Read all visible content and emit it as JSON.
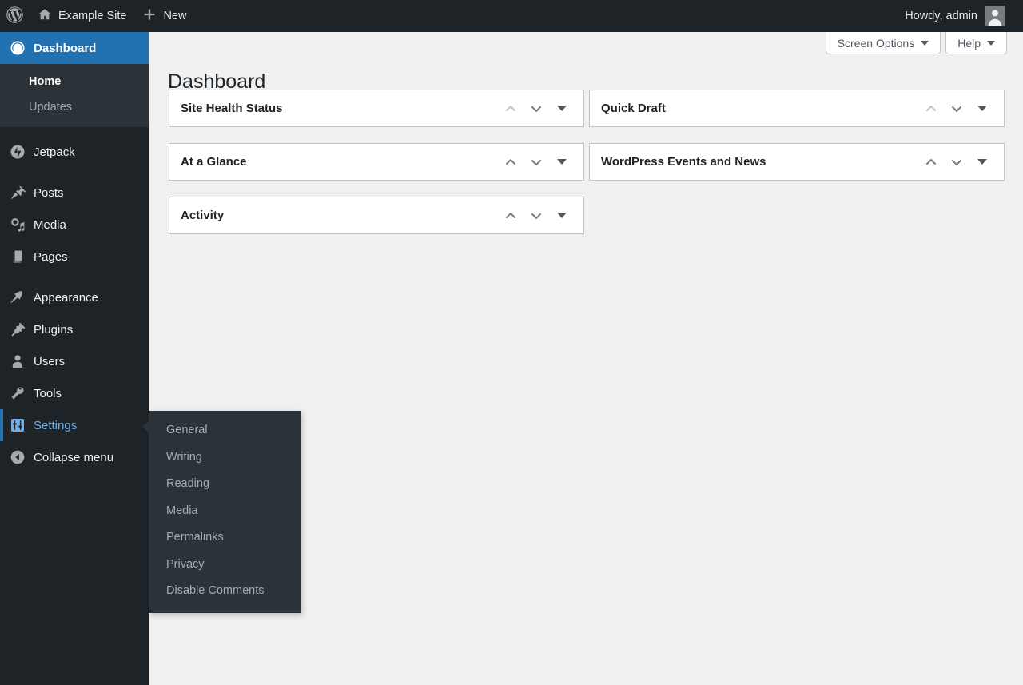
{
  "adminbar": {
    "wp_logo": "wordpress-logo",
    "site_name": "Example Site",
    "new_label": "New",
    "howdy": "Howdy, admin"
  },
  "screen_meta": {
    "screen_options": "Screen Options",
    "help": "Help"
  },
  "page": {
    "title": "Dashboard"
  },
  "sidebar": {
    "items": [
      {
        "label": "Dashboard",
        "icon": "dashboard-icon",
        "state": "current"
      },
      {
        "label": "Jetpack",
        "icon": "jetpack-icon",
        "state": "default"
      },
      {
        "label": "Posts",
        "icon": "pin-icon",
        "state": "default"
      },
      {
        "label": "Media",
        "icon": "media-icon",
        "state": "default"
      },
      {
        "label": "Pages",
        "icon": "pages-icon",
        "state": "default"
      },
      {
        "label": "Appearance",
        "icon": "paintbrush-icon",
        "state": "default"
      },
      {
        "label": "Plugins",
        "icon": "plug-icon",
        "state": "default"
      },
      {
        "label": "Users",
        "icon": "user-icon",
        "state": "default"
      },
      {
        "label": "Tools",
        "icon": "wrench-icon",
        "state": "default"
      },
      {
        "label": "Settings",
        "icon": "settings-sliders-icon",
        "state": "hovered"
      }
    ],
    "dashboard_submenu": [
      {
        "label": "Home",
        "state": "current"
      },
      {
        "label": "Updates",
        "state": "default"
      }
    ],
    "settings_flyout": [
      {
        "label": "General"
      },
      {
        "label": "Writing"
      },
      {
        "label": "Reading"
      },
      {
        "label": "Media"
      },
      {
        "label": "Permalinks"
      },
      {
        "label": "Privacy"
      },
      {
        "label": "Disable Comments"
      }
    ],
    "collapse": {
      "label": "Collapse menu",
      "icon": "collapse-arrow-icon"
    }
  },
  "widgets": {
    "column_left": [
      {
        "title": "Site Health Status"
      },
      {
        "title": "At a Glance"
      },
      {
        "title": "Activity"
      }
    ],
    "column_right": [
      {
        "title": "Quick Draft"
      },
      {
        "title": "WordPress Events and News"
      }
    ]
  },
  "colors": {
    "adminbar_bg": "#1d2327",
    "sidebar_bg": "#1d2327",
    "submenu_bg": "#2c3338",
    "current_blue": "#2271b1",
    "hover_blue": "#72aee6",
    "content_bg": "#f0f0f1",
    "widget_bg": "#ffffff",
    "widget_border": "#c3c4c7"
  }
}
